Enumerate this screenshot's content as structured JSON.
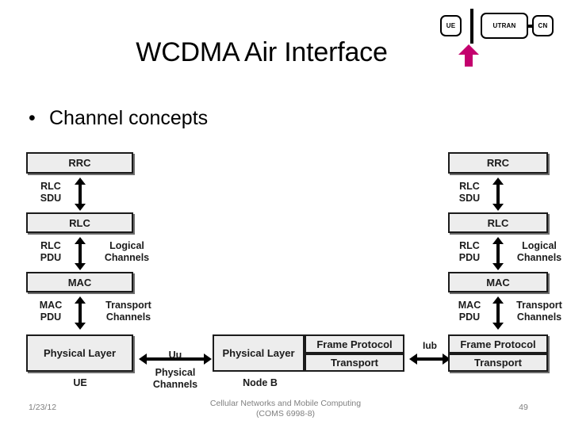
{
  "slide": {
    "title": "WCDMA Air Interface",
    "bullets": [
      {
        "marker": "•",
        "text": "Channel concepts"
      }
    ]
  },
  "navchain": {
    "items": [
      {
        "label": "UE"
      },
      {
        "label": "UTRAN"
      },
      {
        "label": "CN"
      }
    ],
    "highlight_color": "#C4006E",
    "highlight_target": "UE"
  },
  "diagram": {
    "ue_stack": {
      "caption": "UE",
      "boxes": [
        {
          "label": "RRC"
        },
        {
          "label": "RLC"
        },
        {
          "label": "MAC"
        },
        {
          "label": "Physical Layer"
        }
      ],
      "gap_labels": [
        {
          "left": "RLC\nSDU",
          "left_line1": "RLC",
          "left_line2": "SDU",
          "right": ""
        },
        {
          "left_line1": "RLC",
          "left_line2": "PDU",
          "right_line1": "Logical",
          "right_line2": "Channels"
        },
        {
          "left_line1": "MAC",
          "left_line2": "PDU",
          "right_line1": "Transport",
          "right_line2": "Channels"
        }
      ]
    },
    "uu_interface": {
      "name": "Uu",
      "sub_line1": "Physical",
      "sub_line2": "Channels"
    },
    "node_b": {
      "caption": "Node B",
      "left_box": "Physical Layer",
      "right_boxes": [
        {
          "label": "Frame Protocol"
        },
        {
          "label": "Transport"
        }
      ]
    },
    "iub_interface": {
      "name": "Iub"
    },
    "rnc_stack": {
      "boxes": [
        {
          "label": "RRC"
        },
        {
          "label": "RLC"
        },
        {
          "label": "MAC"
        },
        {
          "label": "Frame Protocol"
        },
        {
          "label": "Transport"
        }
      ],
      "gap_labels": [
        {
          "left_line1": "RLC",
          "left_line2": "SDU",
          "right_line1": "",
          "right_line2": ""
        },
        {
          "left_line1": "RLC",
          "left_line2": "PDU",
          "right_line1": "Logical",
          "right_line2": "Channels"
        },
        {
          "left_line1": "MAC",
          "left_line2": "PDU",
          "right_line1": "Transport",
          "right_line2": "Channels"
        }
      ]
    }
  },
  "footer": {
    "date": "1/23/12",
    "course_line1": "Cellular Networks and Mobile Computing",
    "course_line2": "(COMS 6998-8)",
    "page_number": "49"
  }
}
